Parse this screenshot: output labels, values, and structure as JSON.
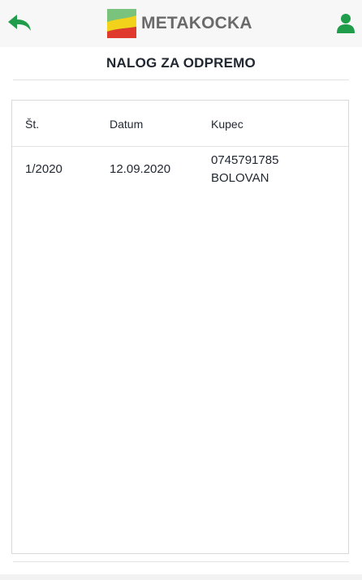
{
  "header": {
    "brand": "METAKOCKA",
    "colors": {
      "accent_green": "#1f9d4a",
      "logo_text": "#6a6a6a",
      "logo_yellow": "#f2d21b",
      "logo_red": "#e03a2f",
      "logo_green": "#4caf50"
    },
    "icons": {
      "back": "back-arrow-icon",
      "user": "user-icon"
    }
  },
  "page": {
    "title": "NALOG ZA ODPREMO"
  },
  "table": {
    "columns": [
      "Št.",
      "Datum",
      "Kupec"
    ],
    "rows": [
      {
        "number": "1/2020",
        "date": "12.09.2020",
        "customer_code": "0745791785",
        "customer_name": "BOLOVAN"
      }
    ]
  }
}
